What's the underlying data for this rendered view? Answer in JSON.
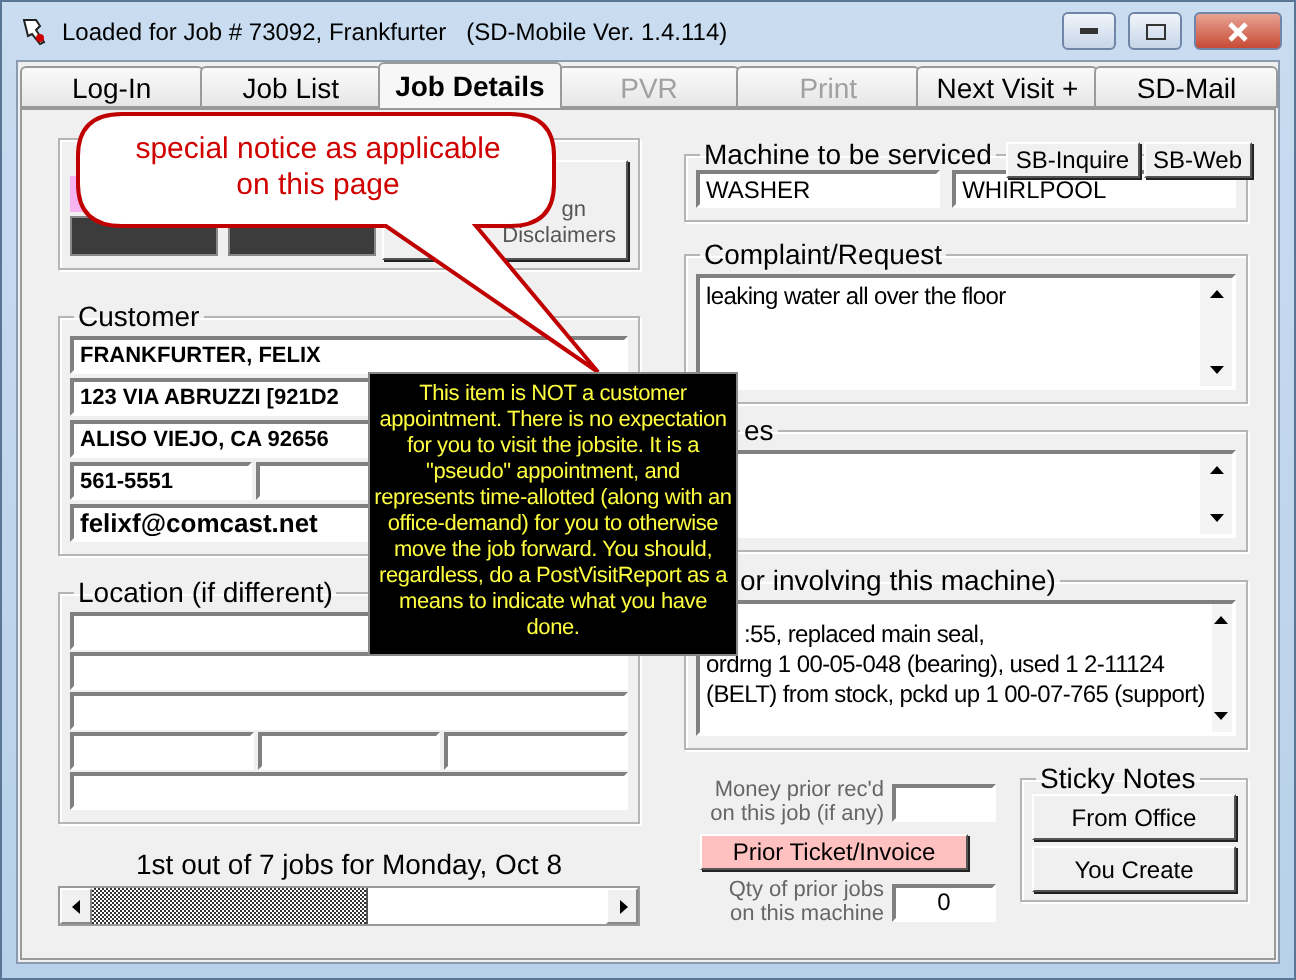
{
  "window": {
    "title": "Loaded for Job # 73092, Frankfurter   (SD-Mobile Ver. 1.4.114)"
  },
  "tabs": [
    {
      "label": "Log-In",
      "selected": false,
      "disabled": false
    },
    {
      "label": "Job List",
      "selected": false,
      "disabled": false
    },
    {
      "label": "Job Details",
      "selected": true,
      "disabled": false
    },
    {
      "label": "PVR",
      "selected": false,
      "disabled": true
    },
    {
      "label": "Print",
      "selected": false,
      "disabled": true
    },
    {
      "label": "Next Visit +",
      "selected": false,
      "disabled": false
    },
    {
      "label": "SD-Mail",
      "selected": false,
      "disabled": false
    }
  ],
  "top_panel": {
    "sign_button": {
      "lines": [
        "gn",
        "Disclaimers"
      ]
    }
  },
  "customer": {
    "label": "Customer",
    "name": "FRANKFURTER, FELIX",
    "address": "123 VIA ABRUZZI [921D2",
    "city": "ALISO VIEJO, CA 92656",
    "phone": "561-5551",
    "email": "felixf@comcast.net"
  },
  "location": {
    "label": "Location (if different)"
  },
  "job_nav": {
    "caption": "1st out of 7 jobs for Monday, Oct 8"
  },
  "machine": {
    "label": "Machine to be serviced",
    "buttons": [
      "SB-Inquire",
      "SB-Web"
    ],
    "type": "WASHER",
    "brand": "WHIRLPOOL"
  },
  "complaint": {
    "label": "Complaint/Request",
    "text": "leaking water all over the floor"
  },
  "notes": {
    "label": "es"
  },
  "history": {
    "label": "or involving this machine)",
    "lines": [
      ":55, replaced main seal,",
      "ordrng 1 00-05-048 (bearing), used 1 2-11124",
      "(BELT) from stock, pckd up 1 00-07-765 (support)"
    ]
  },
  "money": {
    "label_lines": [
      "Money prior rec'd",
      "on this job (if any)"
    ]
  },
  "prior_button": "Prior Ticket/Invoice",
  "qty": {
    "label_lines": [
      "Qty of prior jobs",
      "on this machine"
    ],
    "value": "0"
  },
  "sticky": {
    "label": "Sticky Notes",
    "buttons": [
      "From Office",
      "You Create"
    ]
  },
  "callout": {
    "text": "special notice as applicable on this page"
  },
  "tooltip": {
    "text": "This item is NOT a customer appointment. There is no expectation for you to visit the jobsite.  It is a \"pseudo\" appointment, and represents time-allotted (along with an office-demand) for you to otherwise move the job forward.  You should, regardless, do a PostVisitReport as a means to indicate what you have done."
  }
}
